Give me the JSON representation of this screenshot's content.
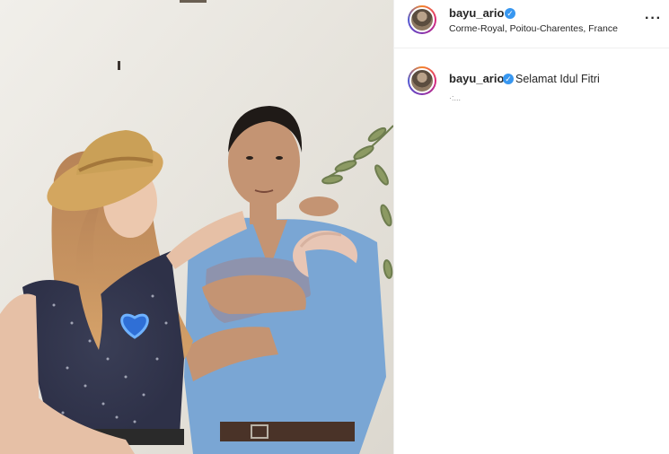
{
  "post": {
    "username": "bayu_ario",
    "location": "Corme-Royal, Poitou-Charentes, France",
    "more_label": "···",
    "caption_username": "bayu_ario",
    "caption_text": "Selamat Idul Fitri",
    "caption_truncated": "·:..."
  },
  "colors": {
    "verified_badge": "#3897f0",
    "heart_sticker": "#2f6fd6",
    "shirt_blue": "#7aa6d4",
    "wall": "#e9e6df"
  },
  "icons": {
    "verified": "verified-badge-icon",
    "more": "more-options-icon",
    "heart": "blue-heart-icon"
  }
}
